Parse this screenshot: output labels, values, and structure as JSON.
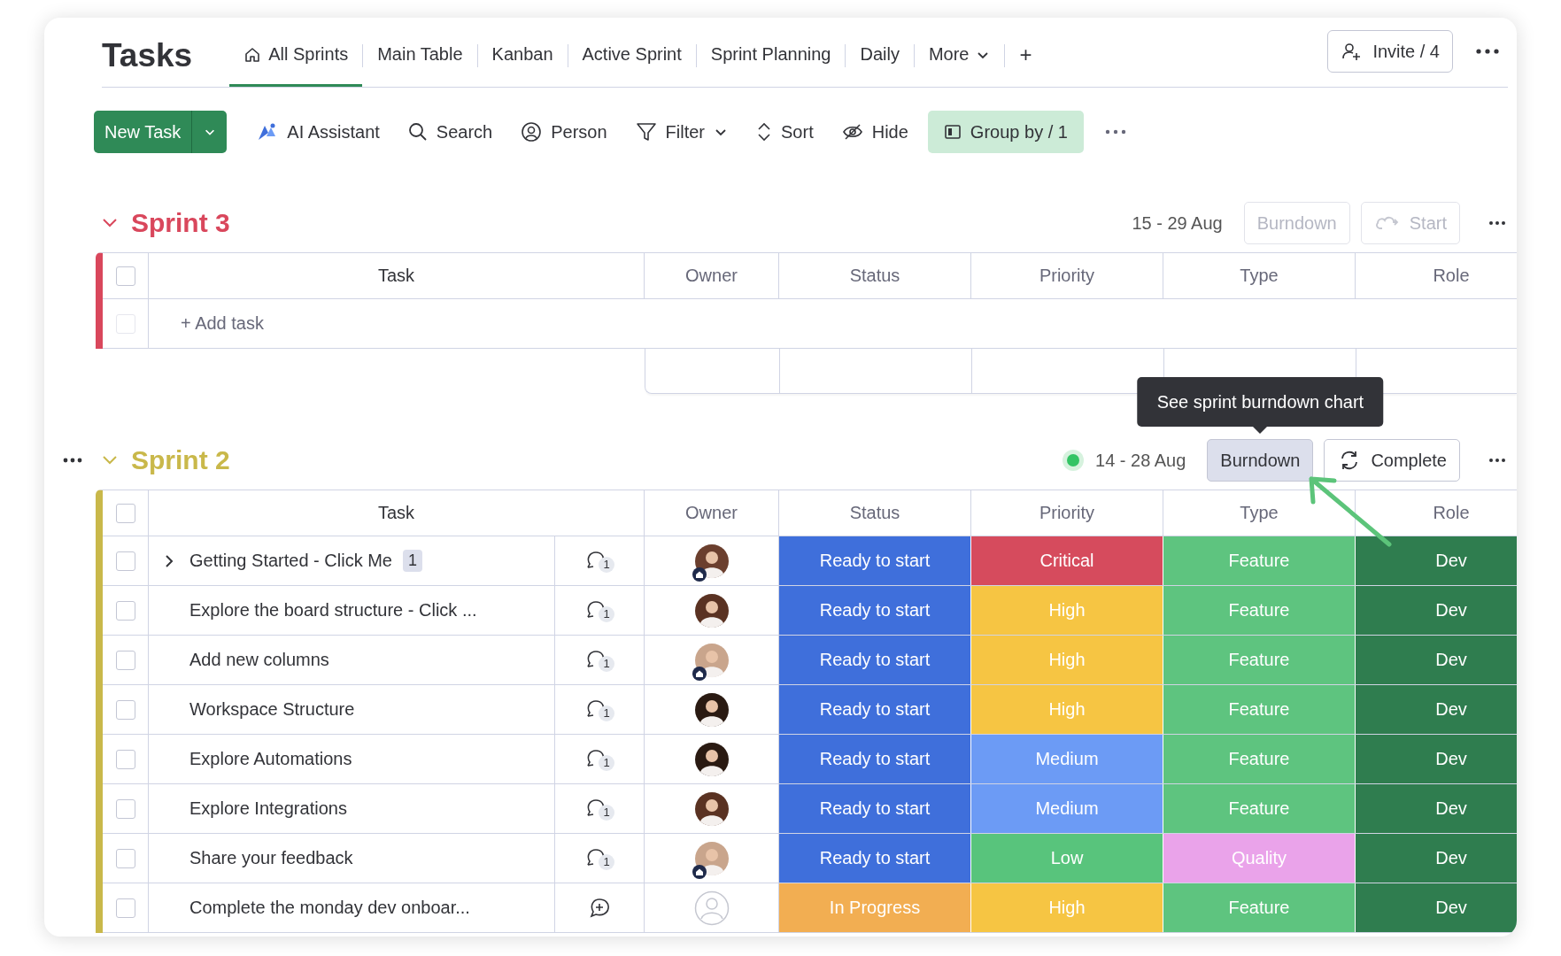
{
  "page_title": "Tasks",
  "tabs": [
    {
      "label": "All Sprints",
      "selected": true
    },
    {
      "label": "Main Table",
      "selected": false
    },
    {
      "label": "Kanban",
      "selected": false
    },
    {
      "label": "Active Sprint",
      "selected": false
    },
    {
      "label": "Sprint Planning",
      "selected": false
    },
    {
      "label": "Daily",
      "selected": false
    }
  ],
  "more_tab": "More",
  "add_tab": "+",
  "invite_button": "Invite / 4",
  "toolbar": {
    "new_task": "New Task",
    "items": [
      {
        "kind": "ai",
        "label": "AI Assistant"
      },
      {
        "kind": "search",
        "label": "Search"
      },
      {
        "kind": "person",
        "label": "Person"
      },
      {
        "kind": "filter",
        "label": "Filter",
        "dropdown": true
      },
      {
        "kind": "sort",
        "label": "Sort"
      },
      {
        "kind": "hide",
        "label": "Hide"
      },
      {
        "kind": "group",
        "label": "Group by / 1",
        "active": true
      }
    ]
  },
  "sprints": [
    {
      "name": "Sprint 3",
      "color": "#d9475c",
      "menu_visible": false,
      "active": false,
      "dates": "15 - 29 Aug",
      "buttons": [
        {
          "kind": "burndown",
          "label": "Burndown",
          "disabled": true,
          "hovered": false
        },
        {
          "kind": "start",
          "label": "Start",
          "disabled": true,
          "hovered": false
        }
      ],
      "columns": [
        "Task",
        "Owner",
        "Status",
        "Priority",
        "Type",
        "Role"
      ],
      "header_checked": false,
      "add_row": {
        "label": "+ Add task",
        "checked": false
      }
    },
    {
      "name": "Sprint 2",
      "color": "#c9b84a",
      "menu_visible": true,
      "active": true,
      "dates": "14 - 28 Aug",
      "buttons": [
        {
          "kind": "burndown",
          "label": "Burndown",
          "disabled": false,
          "hovered": true,
          "tooltip": "See sprint burndown chart"
        },
        {
          "kind": "complete",
          "label": "Complete",
          "disabled": false,
          "hovered": false
        }
      ],
      "columns": [
        "Task",
        "Owner",
        "Status",
        "Priority",
        "Type",
        "Role"
      ],
      "header_checked": false,
      "rows": [
        {
          "checked": false,
          "task": "Getting Started - Click Me",
          "expandable": true,
          "subitems": "1",
          "updates": "1",
          "owner": {
            "kind": "person",
            "color": "#6b3f2e",
            "home_badge": true
          },
          "status": {
            "label": "Ready to start",
            "color": "#3f6fdb"
          },
          "priority": {
            "label": "Critical",
            "color": "#d64b5d"
          },
          "type": {
            "label": "Feature",
            "color": "#5ec47f"
          },
          "role": {
            "label": "Dev",
            "color": "#2f7d4f"
          }
        },
        {
          "checked": false,
          "task": "Explore the board structure - Click ...",
          "expandable": false,
          "updates": "1",
          "owner": {
            "kind": "person",
            "color": "#5a3222",
            "home_badge": false
          },
          "status": {
            "label": "Ready to start",
            "color": "#3f6fdb"
          },
          "priority": {
            "label": "High",
            "color": "#f6c543"
          },
          "type": {
            "label": "Feature",
            "color": "#5ec47f"
          },
          "role": {
            "label": "Dev",
            "color": "#2f7d4f"
          }
        },
        {
          "checked": false,
          "task": "Add new columns",
          "expandable": false,
          "updates": "1",
          "owner": {
            "kind": "person",
            "color": "#c9a58c",
            "home_badge": true
          },
          "status": {
            "label": "Ready to start",
            "color": "#3f6fdb"
          },
          "priority": {
            "label": "High",
            "color": "#f6c543"
          },
          "type": {
            "label": "Feature",
            "color": "#5ec47f"
          },
          "role": {
            "label": "Dev",
            "color": "#2f7d4f"
          }
        },
        {
          "checked": false,
          "task": "Workspace Structure",
          "expandable": false,
          "updates": "1",
          "owner": {
            "kind": "person",
            "color": "#2a1a12",
            "home_badge": false
          },
          "status": {
            "label": "Ready to start",
            "color": "#3f6fdb"
          },
          "priority": {
            "label": "High",
            "color": "#f6c543"
          },
          "type": {
            "label": "Feature",
            "color": "#5ec47f"
          },
          "role": {
            "label": "Dev",
            "color": "#2f7d4f"
          }
        },
        {
          "checked": false,
          "task": "Explore Automations",
          "expandable": false,
          "updates": "1",
          "owner": {
            "kind": "person",
            "color": "#2a1a12",
            "home_badge": false
          },
          "status": {
            "label": "Ready to start",
            "color": "#3f6fdb"
          },
          "priority": {
            "label": "Medium",
            "color": "#6c9bf5"
          },
          "type": {
            "label": "Feature",
            "color": "#5ec47f"
          },
          "role": {
            "label": "Dev",
            "color": "#2f7d4f"
          }
        },
        {
          "checked": false,
          "task": "Explore Integrations",
          "expandable": false,
          "updates": "1",
          "owner": {
            "kind": "person",
            "color": "#5a3222",
            "home_badge": false
          },
          "status": {
            "label": "Ready to start",
            "color": "#3f6fdb"
          },
          "priority": {
            "label": "Medium",
            "color": "#6c9bf5"
          },
          "type": {
            "label": "Feature",
            "color": "#5ec47f"
          },
          "role": {
            "label": "Dev",
            "color": "#2f7d4f"
          }
        },
        {
          "checked": false,
          "task": "Share your feedback",
          "expandable": false,
          "updates": "1",
          "owner": {
            "kind": "person",
            "color": "#c9a58c",
            "home_badge": true
          },
          "status": {
            "label": "Ready to start",
            "color": "#3f6fdb"
          },
          "priority": {
            "label": "Low",
            "color": "#58c47c"
          },
          "type": {
            "label": "Quality",
            "color": "#eaa3ea"
          },
          "role": {
            "label": "Dev",
            "color": "#2f7d4f"
          }
        },
        {
          "checked": false,
          "task": "Complete the monday dev onboar...",
          "expandable": false,
          "owner": {
            "kind": "empty"
          },
          "status": {
            "label": "In Progress",
            "color": "#f2ae52"
          },
          "priority": {
            "label": "High",
            "color": "#f6c543"
          },
          "type": {
            "label": "Feature",
            "color": "#5ec47f"
          },
          "role": {
            "label": "Dev",
            "color": "#2f7d4f"
          }
        }
      ]
    }
  ],
  "pointer_arrow": {
    "color": "#5cc47a"
  }
}
